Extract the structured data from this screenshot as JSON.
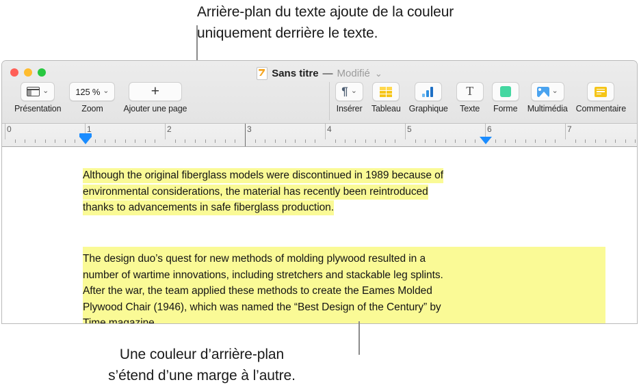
{
  "callouts": {
    "top": "Arrière-plan du texte ajoute de la couleur\nuniquement derrière le texte.",
    "bottom": "Une couleur d’arrière-plan\ns’étend d’une marge à l’autre."
  },
  "window": {
    "traffic_lights": [
      "close",
      "minimize",
      "zoom"
    ],
    "title": {
      "doc_icon": "pages-document-icon",
      "name": "Sans titre",
      "separator": "—",
      "status": "Modifié",
      "chevron": "⌄"
    }
  },
  "toolbar": {
    "items": [
      {
        "label": "Présentation",
        "icon": "layout-icon",
        "has_chevron": true,
        "value": ""
      },
      {
        "label": "Zoom",
        "icon": "zoom-value",
        "has_chevron": true,
        "value": "125 %"
      },
      {
        "label": "Ajouter une page",
        "icon": "plus-icon",
        "has_chevron": false,
        "value": ""
      },
      {
        "label": "Insérer",
        "icon": "pilcrow-icon",
        "has_chevron": true,
        "value": ""
      },
      {
        "label": "Tableau",
        "icon": "table-icon",
        "has_chevron": false,
        "value": ""
      },
      {
        "label": "Graphique",
        "icon": "bar-chart-icon",
        "has_chevron": false,
        "value": ""
      },
      {
        "label": "Texte",
        "icon": "text-t-icon",
        "has_chevron": false,
        "value": ""
      },
      {
        "label": "Forme",
        "icon": "shape-icon",
        "has_chevron": false,
        "value": ""
      },
      {
        "label": "Multimédia",
        "icon": "media-icon",
        "has_chevron": true,
        "value": ""
      },
      {
        "label": "Commentaire",
        "icon": "comment-icon",
        "has_chevron": false,
        "value": ""
      }
    ]
  },
  "ruler": {
    "numbers": [
      "0",
      "1",
      "2",
      "3",
      "4",
      "5",
      "6",
      "7"
    ],
    "left_margin_marker": "1",
    "right_margin_marker": "6"
  },
  "document": {
    "paragraph_1": {
      "style": "text-background",
      "lines": [
        "Although the original fiberglass models were discontinued in 1989 because of",
        "environmental considerations, the material has recently been reintroduced",
        "thanks to advancements in safe fiberglass production."
      ]
    },
    "paragraph_2": {
      "style": "paragraph-background",
      "lines": [
        "The design duo’s quest for new methods of molding plywood resulted in a",
        "number of wartime innovations, including stretchers and stackable leg splints.",
        "After the war, the team applied these methods to create the Eames Molded",
        "Plywood Chair (1946), which was named the “Best Design of the Century” by",
        "Time magazine."
      ]
    }
  },
  "colors": {
    "highlight": "#fafa96",
    "accent_blue": "#1a8cff",
    "shape_green": "#44d7a1",
    "table_yellow": "#f5c518"
  }
}
